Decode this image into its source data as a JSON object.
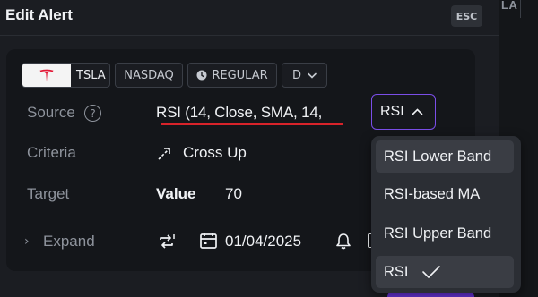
{
  "header": {
    "title": "Edit Alert",
    "esc_label": "ESC"
  },
  "side": {
    "fragment": "LA"
  },
  "symbol_bar": {
    "ticker": "TSLA",
    "exchange": "NASDAQ",
    "session": "REGULAR",
    "interval": "D"
  },
  "form": {
    "source": {
      "label": "Source",
      "value": "RSI (14, Close, SMA, 14,"
    },
    "criteria": {
      "label": "Criteria",
      "value": "Cross Up"
    },
    "target": {
      "label": "Target",
      "type": "Value",
      "value": "70"
    },
    "expand": {
      "label": "Expand"
    },
    "date": "01/04/2025"
  },
  "dropdown": {
    "selected": "RSI",
    "options": [
      "RSI Lower Band",
      "RSI-based MA",
      "RSI Upper Band",
      "RSI"
    ],
    "checked_option": "RSI"
  },
  "colors": {
    "accent": "#7b4ee8",
    "underline": "#d8232a",
    "tesla_red": "#e31937"
  }
}
